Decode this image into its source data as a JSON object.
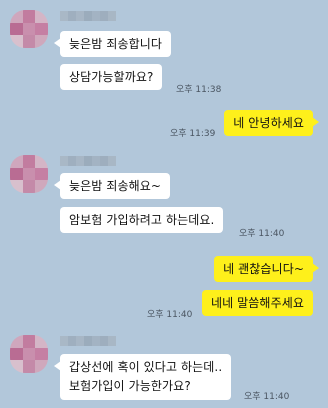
{
  "colors": {
    "background": "#b2c7da",
    "incoming_bubble": "#ffffff",
    "outgoing_bubble": "#fef01b",
    "timestamp": "#4a5561"
  },
  "messages": [
    {
      "side": "incoming",
      "text": "늦은밤 죄송합니다"
    },
    {
      "side": "incoming",
      "text": "상담가능할까요?",
      "time": "오후 11:38"
    },
    {
      "side": "outgoing",
      "text": "네 안녕하세요",
      "time": "오후 11:39"
    },
    {
      "side": "incoming",
      "text": "늦은밤 죄송해요~"
    },
    {
      "side": "incoming",
      "text": "암보험 가입하려고 하는데요.",
      "time": "오후 11:40"
    },
    {
      "side": "outgoing",
      "text": "네 괜찮습니다~"
    },
    {
      "side": "outgoing",
      "text": "네네 말씀해주세요",
      "time": "오후 11:40"
    },
    {
      "side": "incoming",
      "lines": [
        "갑상선에 혹이 있다고 하는데..",
        "보험가입이 가능한가요?"
      ],
      "time": "오후 11:40"
    }
  ],
  "avatar_icon": "blurred-profile-avatar",
  "sender_name_icon": "blurred-sender-name"
}
